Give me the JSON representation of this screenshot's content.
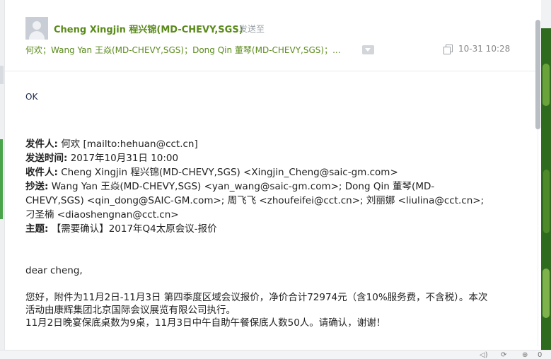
{
  "header": {
    "sender": "Cheng Xingjin 程兴锦(MD-CHEVY,SGS)",
    "sent_to_label": "发送至",
    "recipients": "何欢；Wang Yan 王焱(MD-CHEVY,SGS)；Dong Qin 董琴(MD-CHEVY,SGS)；...",
    "timestamp": "10-31 10:28"
  },
  "body": {
    "reply": "OK",
    "quoted": {
      "from_label": "发件人:",
      "from_value": " 何欢 [mailto:hehuan@cct.cn]",
      "sent_label": "发送时间:",
      "sent_value": " 2017年10月31日 10:00",
      "to_label": "收件人:",
      "to_value": " Cheng Xingjin 程兴锦(MD-CHEVY,SGS) <Xingjin_Cheng@saic-gm.com>",
      "cc_label": "抄送:",
      "cc_line1": " Wang Yan 王焱(MD-CHEVY,SGS) <yan_wang@saic-gm.com>; Dong Qin 董琴(MD-",
      "cc_line2": "CHEVY,SGS) <qin_dong@SAIC-GM.com>; 周飞飞 <zhoufeifei@cct.cn>; 刘丽娜 <liulina@cct.cn>;",
      "cc_line3": "刁圣楠 <diaoshengnan@cct.cn>",
      "subject_label": "主题:",
      "subject_value": " 【需要确认】2017年Q4太原会议-报价"
    },
    "greeting": "dear cheng,",
    "para1_line1": "您好，附件为11月2日-11月3日 第四季度区域会议报价，净价合计72974元（含10%服务费，不含税）。本次",
    "para1_line2": "活动由康辉集团北京国际会议展览有限公司执行。",
    "para2": "11月2日晚宴保底桌数为9桌，11月3日中午自助午餐保底人数50人。请确认，谢谢！"
  },
  "statusbar": {
    "count": "0"
  },
  "icons": [
    "avatar-icon",
    "expand-recipients-icon",
    "copy-icon",
    "speaker-icon",
    "sync-icon",
    "share-icon"
  ]
}
